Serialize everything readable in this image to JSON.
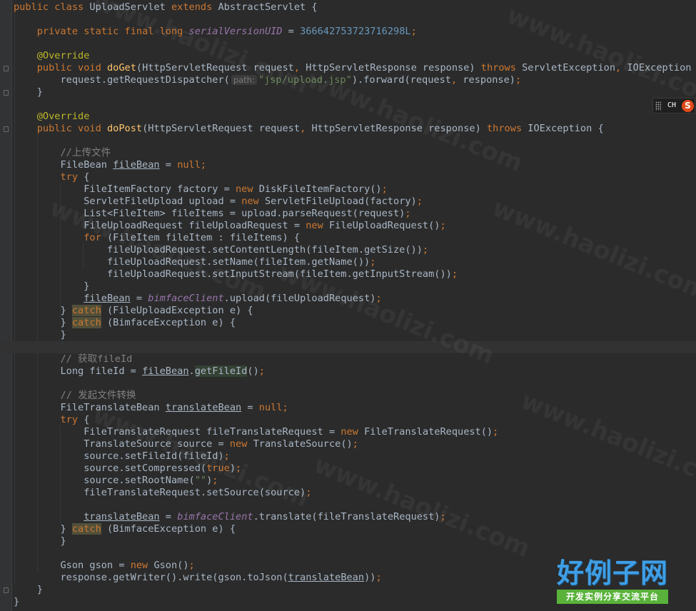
{
  "editor": {
    "lines": [
      {
        "n": 0,
        "tokens": [
          {
            "t": "public class ",
            "c": "kw"
          },
          {
            "t": "UploadServlet "
          },
          {
            "t": "extends ",
            "c": "kw"
          },
          {
            "t": "AbstractServlet {"
          }
        ]
      },
      {
        "n": 1,
        "tokens": []
      },
      {
        "n": 2,
        "tokens": [
          {
            "t": "    "
          },
          {
            "t": "private static final long ",
            "c": "kw"
          },
          {
            "t": "serialVersionUID",
            "c": "fieldc"
          },
          {
            "t": " = "
          },
          {
            "t": "366642753723716298L",
            "c": "num"
          },
          {
            "t": ";",
            "c": "kw"
          }
        ]
      },
      {
        "n": 3,
        "tokens": []
      },
      {
        "n": 4,
        "tokens": [
          {
            "t": "    "
          },
          {
            "t": "@Override",
            "c": "ann"
          }
        ]
      },
      {
        "n": 5,
        "tokens": [
          {
            "t": "    "
          },
          {
            "t": "public void ",
            "c": "kw"
          },
          {
            "t": "doGet",
            "c": "fn"
          },
          {
            "t": "(HttpServletRequest request"
          },
          {
            "t": ", ",
            "c": "kw"
          },
          {
            "t": "HttpServletResponse response) "
          },
          {
            "t": "throws ",
            "c": "kw"
          },
          {
            "t": "ServletException"
          },
          {
            "t": ", ",
            "c": "kw"
          },
          {
            "t": "IOException {"
          }
        ]
      },
      {
        "n": 6,
        "tokens": [
          {
            "t": "        request.getRequestDispatcher("
          },
          {
            "t": "path:",
            "c": "hint"
          },
          {
            "t": "\"jsp/upload.jsp\"",
            "c": "str"
          },
          {
            "t": ").forward(request"
          },
          {
            "t": ", ",
            "c": "kw"
          },
          {
            "t": "response)"
          },
          {
            "t": ";",
            "c": "kw"
          }
        ]
      },
      {
        "n": 7,
        "tokens": [
          {
            "t": "    }"
          }
        ]
      },
      {
        "n": 8,
        "tokens": []
      },
      {
        "n": 9,
        "tokens": [
          {
            "t": "    "
          },
          {
            "t": "@Override",
            "c": "ann"
          }
        ]
      },
      {
        "n": 10,
        "tokens": [
          {
            "t": "    "
          },
          {
            "t": "public void ",
            "c": "kw"
          },
          {
            "t": "doPost",
            "c": "fn"
          },
          {
            "t": "(HttpServletRequest request"
          },
          {
            "t": ", ",
            "c": "kw"
          },
          {
            "t": "HttpServletResponse response) "
          },
          {
            "t": "throws ",
            "c": "kw"
          },
          {
            "t": "IOException {"
          }
        ]
      },
      {
        "n": 11,
        "tokens": []
      },
      {
        "n": 12,
        "tokens": [
          {
            "t": "        "
          },
          {
            "t": "//上传文件",
            "c": "cmt"
          }
        ]
      },
      {
        "n": 13,
        "tokens": [
          {
            "t": "        FileBean "
          },
          {
            "t": "fileBean",
            "c": "ul"
          },
          {
            "t": " = "
          },
          {
            "t": "null;",
            "c": "kw"
          }
        ]
      },
      {
        "n": 14,
        "tokens": [
          {
            "t": "        "
          },
          {
            "t": "try ",
            "c": "kw"
          },
          {
            "t": "{"
          }
        ]
      },
      {
        "n": 15,
        "tokens": [
          {
            "t": "            FileItemFactory factory = "
          },
          {
            "t": "new ",
            "c": "kw"
          },
          {
            "t": "DiskFileItemFactory()"
          },
          {
            "t": ";",
            "c": "kw"
          }
        ]
      },
      {
        "n": 16,
        "tokens": [
          {
            "t": "            ServletFileUpload upload = "
          },
          {
            "t": "new ",
            "c": "kw"
          },
          {
            "t": "ServletFileUpload(factory)"
          },
          {
            "t": ";",
            "c": "kw"
          }
        ]
      },
      {
        "n": 17,
        "tokens": [
          {
            "t": "            List<FileItem> fileItems = upload.parseRequest(request)"
          },
          {
            "t": ";",
            "c": "kw"
          }
        ]
      },
      {
        "n": 18,
        "tokens": [
          {
            "t": "            FileUploadRequest fileUploadRequest = "
          },
          {
            "t": "new ",
            "c": "kw"
          },
          {
            "t": "FileUploadRequest()"
          },
          {
            "t": ";",
            "c": "kw"
          }
        ]
      },
      {
        "n": 19,
        "tokens": [
          {
            "t": "            "
          },
          {
            "t": "for ",
            "c": "kw"
          },
          {
            "t": "(FileItem fileItem : fileItems) {"
          }
        ]
      },
      {
        "n": 20,
        "tokens": [
          {
            "t": "                fileUploadRequest.setContentLength(fileItem.getSize())"
          },
          {
            "t": ";",
            "c": "kw"
          }
        ]
      },
      {
        "n": 21,
        "tokens": [
          {
            "t": "                fileUploadRequest.setName(fileItem.getName())"
          },
          {
            "t": ";",
            "c": "kw"
          }
        ]
      },
      {
        "n": 22,
        "tokens": [
          {
            "t": "                fileUploadRequest.setInputStream(fileItem.getInputStream())"
          },
          {
            "t": ";",
            "c": "kw"
          }
        ]
      },
      {
        "n": 23,
        "tokens": [
          {
            "t": "            }"
          }
        ]
      },
      {
        "n": 24,
        "tokens": [
          {
            "t": "            "
          },
          {
            "t": "fileBean",
            "c": "ul"
          },
          {
            "t": " = "
          },
          {
            "t": "bimfaceClient",
            "c": "fieldc"
          },
          {
            "t": ".upload(fileUploadRequest)"
          },
          {
            "t": ";",
            "c": "kw"
          }
        ]
      },
      {
        "n": 25,
        "tokens": [
          {
            "t": "        } "
          },
          {
            "t": "catch",
            "c": "kw hlw"
          },
          {
            "t": " (FileUploadException e) {"
          }
        ]
      },
      {
        "n": 26,
        "tokens": [
          {
            "t": "        } "
          },
          {
            "t": "catch",
            "c": "kw hlw"
          },
          {
            "t": " (BimfaceException e) {"
          }
        ]
      },
      {
        "n": 27,
        "tokens": [
          {
            "t": "        }"
          }
        ]
      },
      {
        "n": 28,
        "tokens": [],
        "current": true
      },
      {
        "n": 29,
        "tokens": [
          {
            "t": "        "
          },
          {
            "t": "// 获取fileId",
            "c": "cmt"
          }
        ]
      },
      {
        "n": 30,
        "tokens": [
          {
            "t": "        Long fileId = "
          },
          {
            "t": "fileBean",
            "c": "ul"
          },
          {
            "t": "."
          },
          {
            "t": "getFileId",
            "c": "hlu"
          },
          {
            "t": "()"
          },
          {
            "t": ";",
            "c": "kw"
          }
        ]
      },
      {
        "n": 31,
        "tokens": []
      },
      {
        "n": 32,
        "tokens": [
          {
            "t": "        "
          },
          {
            "t": "// 发起文件转换",
            "c": "cmt"
          }
        ]
      },
      {
        "n": 33,
        "tokens": [
          {
            "t": "        FileTranslateBean "
          },
          {
            "t": "translateBean",
            "c": "ul"
          },
          {
            "t": " = "
          },
          {
            "t": "null;",
            "c": "kw"
          }
        ]
      },
      {
        "n": 34,
        "tokens": [
          {
            "t": "        "
          },
          {
            "t": "try ",
            "c": "kw"
          },
          {
            "t": "{"
          }
        ]
      },
      {
        "n": 35,
        "tokens": [
          {
            "t": "            FileTranslateRequest fileTranslateRequest = "
          },
          {
            "t": "new ",
            "c": "kw"
          },
          {
            "t": "FileTranslateRequest()"
          },
          {
            "t": ";",
            "c": "kw"
          }
        ]
      },
      {
        "n": 36,
        "tokens": [
          {
            "t": "            TranslateSource source = "
          },
          {
            "t": "new ",
            "c": "kw"
          },
          {
            "t": "TranslateSource()"
          },
          {
            "t": ";",
            "c": "kw"
          }
        ]
      },
      {
        "n": 37,
        "tokens": [
          {
            "t": "            source.setFileId(fileId)"
          },
          {
            "t": ";",
            "c": "kw"
          }
        ]
      },
      {
        "n": 38,
        "tokens": [
          {
            "t": "            source.setCompressed("
          },
          {
            "t": "true",
            "c": "kw"
          },
          {
            "t": ")"
          },
          {
            "t": ";",
            "c": "kw"
          }
        ]
      },
      {
        "n": 39,
        "tokens": [
          {
            "t": "            source.setRootName("
          },
          {
            "t": "\"\"",
            "c": "str"
          },
          {
            "t": ")"
          },
          {
            "t": ";",
            "c": "kw"
          }
        ]
      },
      {
        "n": 40,
        "tokens": [
          {
            "t": "            fileTranslateRequest.setSource(source)"
          },
          {
            "t": ";",
            "c": "kw"
          }
        ]
      },
      {
        "n": 41,
        "tokens": []
      },
      {
        "n": 42,
        "tokens": [
          {
            "t": "            "
          },
          {
            "t": "translateBean",
            "c": "ul"
          },
          {
            "t": " = "
          },
          {
            "t": "bimfaceClient",
            "c": "fieldc"
          },
          {
            "t": ".translate(fileTranslateRequest)"
          },
          {
            "t": ";",
            "c": "kw"
          }
        ]
      },
      {
        "n": 43,
        "tokens": [
          {
            "t": "        } "
          },
          {
            "t": "catch",
            "c": "kw hlw"
          },
          {
            "t": " (BimfaceException e) {"
          }
        ]
      },
      {
        "n": 44,
        "tokens": [
          {
            "t": "        }"
          }
        ]
      },
      {
        "n": 45,
        "tokens": []
      },
      {
        "n": 46,
        "tokens": [
          {
            "t": "        Gson gson = "
          },
          {
            "t": "new ",
            "c": "kw"
          },
          {
            "t": "Gson()"
          },
          {
            "t": ";",
            "c": "kw"
          }
        ]
      },
      {
        "n": 47,
        "tokens": [
          {
            "t": "        response.getWriter().write(gson.toJson("
          },
          {
            "t": "translateBean",
            "c": "ul"
          },
          {
            "t": "))"
          },
          {
            "t": ";",
            "c": "kw"
          }
        ]
      },
      {
        "n": 48,
        "tokens": [
          {
            "t": "    }"
          }
        ]
      },
      {
        "n": 49,
        "tokens": [
          {
            "t": "}"
          }
        ]
      }
    ]
  },
  "ime": {
    "mode": "CH",
    "icon": "S"
  },
  "watermark": {
    "text": "www.haolizi.com"
  },
  "logo": {
    "title": "好例子网",
    "subtitle": "开发实例分享交流平台"
  }
}
